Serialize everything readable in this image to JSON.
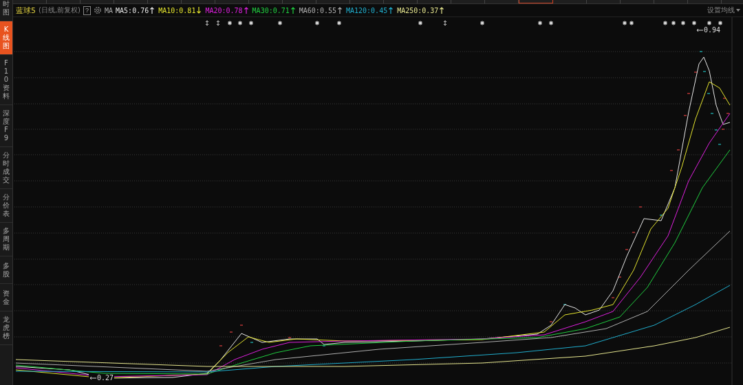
{
  "sidebar": {
    "items": [
      {
        "label": "时图",
        "selected": false
      },
      {
        "label": "K线图",
        "selected": true
      },
      {
        "label": "F10资料",
        "selected": false
      },
      {
        "label": "深度F9",
        "selected": false
      },
      {
        "label": "分时成交",
        "selected": false
      },
      {
        "label": "分价表",
        "selected": false
      },
      {
        "label": "多周期",
        "selected": false
      },
      {
        "label": "多股",
        "selected": false
      },
      {
        "label": "资金",
        "selected": false
      },
      {
        "label": "龙虎榜",
        "selected": false
      }
    ]
  },
  "legend": {
    "title": "蓝球5",
    "subtitle": "(日线,前复权)",
    "help": "?",
    "ma_label": "MA",
    "settings": "设置均线",
    "averages": [
      {
        "text": "MA5:0.76",
        "rising": true,
        "color": "#e8e8e8"
      },
      {
        "text": "MA10:0.81",
        "rising": false,
        "color": "#e6e62e"
      },
      {
        "text": "MA20:0.78",
        "rising": true,
        "color": "#e020e0"
      },
      {
        "text": "MA30:0.71",
        "rising": true,
        "color": "#20d040"
      },
      {
        "text": "MA60:0.55",
        "rising": true,
        "color": "#b0b0b0"
      },
      {
        "text": "MA120:0.45",
        "rising": true,
        "color": "#20b0d0"
      },
      {
        "text": "MA250:0.37",
        "rising": true,
        "color": "#e8e890"
      }
    ]
  },
  "chart": {
    "high_label": "0.94",
    "low_label": "0.27"
  }
}
